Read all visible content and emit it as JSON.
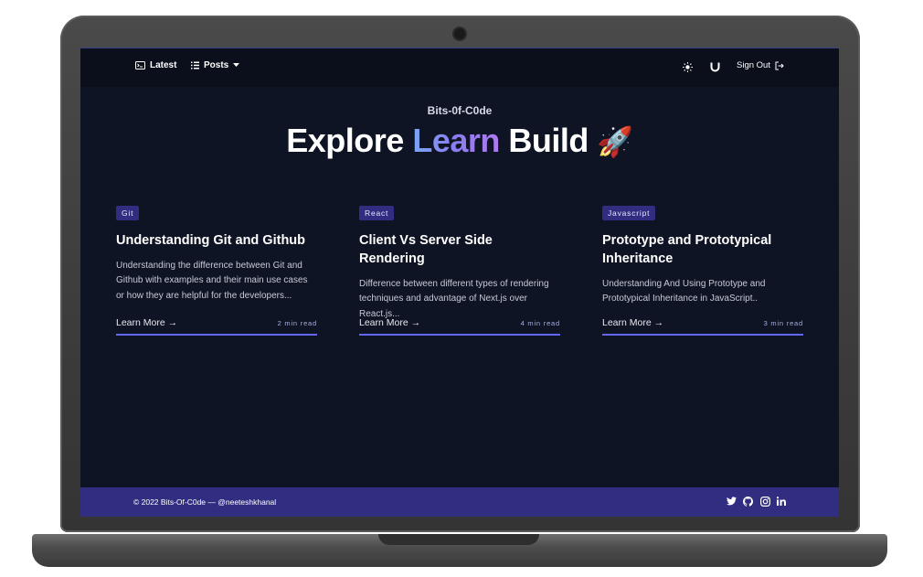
{
  "nav": {
    "latest_label": "Latest",
    "posts_label": "Posts",
    "signout_label": "Sign Out"
  },
  "hero": {
    "subtitle": "Bits-0f-C0de",
    "title_word1": "Explore",
    "title_word2": "Learn",
    "title_word3": "Build",
    "title_emoji": "🚀"
  },
  "posts": [
    {
      "tag": "Git",
      "title": "Understanding Git and Github",
      "description": "Understanding the difference between Git and Github with examples and their main use cases or how they are helpful for the developers...",
      "learn_more": "Learn More →",
      "read_time": "2 min read"
    },
    {
      "tag": "React",
      "title": "Client Vs Server Side Rendering",
      "description": "Difference between different types of rendering techniques and advantage of Next.js over React.js...",
      "learn_more": "Learn More →",
      "read_time": "4 min read"
    },
    {
      "tag": "Javascript",
      "title": "Prototype and Prototypical Inheritance",
      "description": "Understanding And Using Prototype and Prototypical Inheritance in JavaScript..",
      "learn_more": "Learn More →",
      "read_time": "3 min read"
    }
  ],
  "footer": {
    "copyright": "© 2022 Bits-Of-C0de — @neeteshkhanal",
    "social_icons": [
      "twitter-icon",
      "github-icon",
      "instagram-icon",
      "linkedin-icon"
    ]
  },
  "colors": {
    "background": "#0f1424",
    "navbar": "#0b0f1c",
    "accent": "#6366f1",
    "tag_bg": "#312e81",
    "footer_bg": "#312e81"
  }
}
